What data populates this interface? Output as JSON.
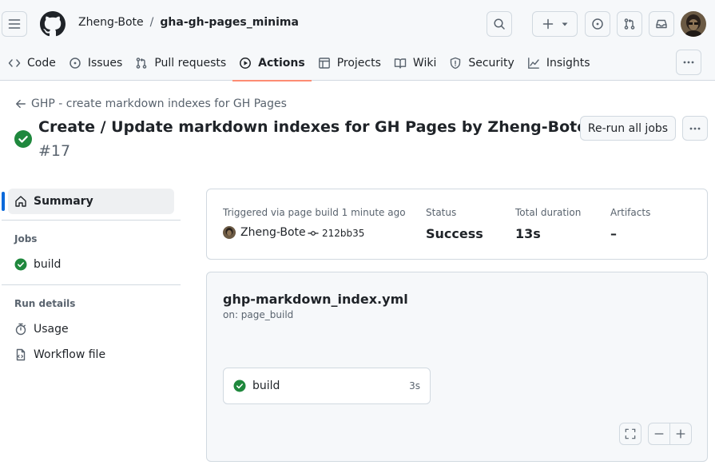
{
  "header": {
    "owner": "Zheng-Bote",
    "separator": "/",
    "repo": "gha-gh-pages_minima"
  },
  "repo_nav": {
    "items": [
      {
        "label": "Code",
        "icon": "code-icon"
      },
      {
        "label": "Issues",
        "icon": "issue-opened-icon"
      },
      {
        "label": "Pull requests",
        "icon": "git-pull-request-icon"
      },
      {
        "label": "Actions",
        "icon": "play-icon",
        "active": true
      },
      {
        "label": "Projects",
        "icon": "table-icon"
      },
      {
        "label": "Wiki",
        "icon": "book-icon"
      },
      {
        "label": "Security",
        "icon": "shield-icon"
      },
      {
        "label": "Insights",
        "icon": "graph-icon"
      }
    ]
  },
  "run": {
    "back_link": "GHP - create markdown indexes for GH Pages",
    "title": "Create / Update markdown indexes for GH Pages by Zheng-Bote",
    "number": "#17",
    "status_icon": "check-circle-fill-icon",
    "rerun_label": "Re-run all jobs"
  },
  "sidebar": {
    "summary_label": "Summary",
    "jobs_heading": "Jobs",
    "jobs": [
      {
        "label": "build",
        "status_icon": "check-circle-fill-icon"
      }
    ],
    "run_details_heading": "Run details",
    "details": [
      {
        "label": "Usage",
        "icon": "stopwatch-icon"
      },
      {
        "label": "Workflow file",
        "icon": "file-icon"
      }
    ]
  },
  "summary_card": {
    "triggered_label": "Triggered via page build 1 minute ago",
    "actor": "Zheng-Bote",
    "commit": "212bb35",
    "status_label": "Status",
    "status_value": "Success",
    "duration_label": "Total duration",
    "duration_value": "13s",
    "artifacts_label": "Artifacts",
    "artifacts_value": "–"
  },
  "workflow_graph": {
    "file_name": "ghp-markdown_index.yml",
    "trigger": "on: page_build",
    "jobs": [
      {
        "label": "build",
        "duration": "3s",
        "status_icon": "check-circle-fill-icon"
      }
    ]
  },
  "colors": {
    "success": "#1f883d",
    "accent": "#0969da",
    "nav_underline": "#fd8c73",
    "border": "#d1d9e0",
    "muted_text": "#59636e"
  }
}
